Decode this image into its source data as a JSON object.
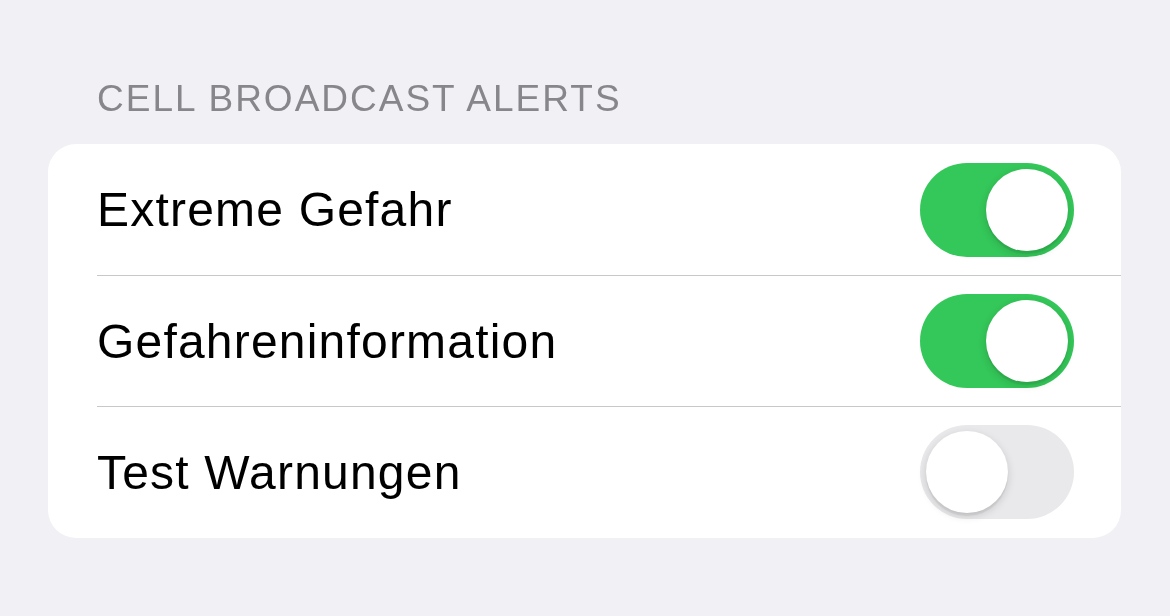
{
  "section": {
    "title": "CELL BROADCAST ALERTS",
    "items": [
      {
        "label": "Extreme Gefahr",
        "on": true
      },
      {
        "label": "Gefahreninformation",
        "on": true
      },
      {
        "label": "Test Warnungen",
        "on": false
      }
    ]
  }
}
